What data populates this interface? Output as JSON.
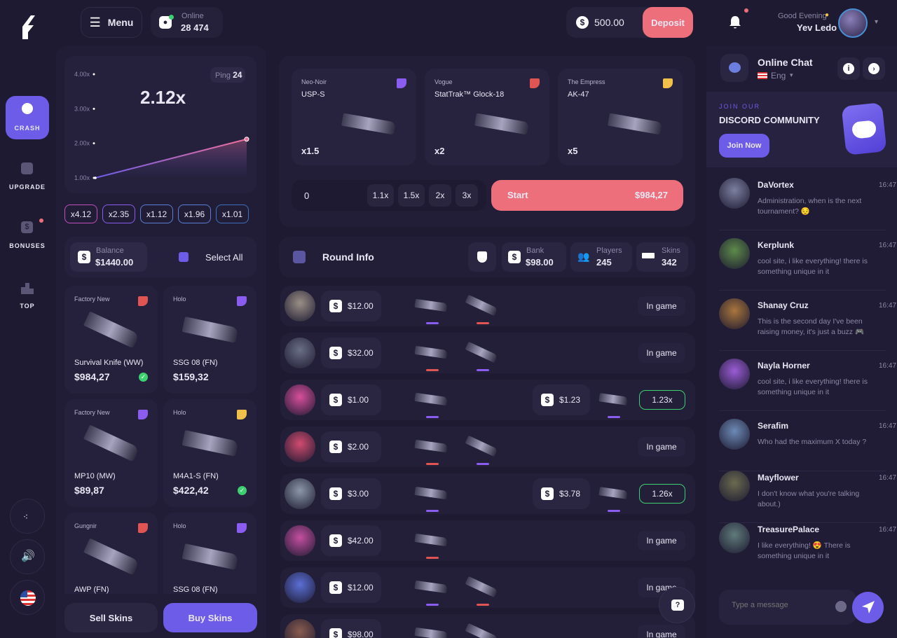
{
  "colors": {
    "bg": "#1d1a31",
    "panel": "#231f39",
    "accent": "#6c5ce7",
    "deposit": "#ee6f7c",
    "start": "#ee6f7c"
  },
  "header": {
    "menu_label": "Menu",
    "online_label": "Online",
    "online_count": "28 474",
    "balance": "500.00",
    "deposit_label": "Deposit",
    "greeting": "Good Evening",
    "username": "Yev Ledo"
  },
  "sidebar": {
    "items": [
      {
        "label": "CRASH",
        "icon": "bomb-icon"
      },
      {
        "label": "UPGRADE",
        "icon": "chart-up-icon"
      },
      {
        "label": "BONUSES",
        "icon": "dollar-icon"
      },
      {
        "label": "TOP",
        "icon": "podium-icon"
      }
    ]
  },
  "crash": {
    "multiplier": "2.12x",
    "ping_label": "Ping",
    "ping_value": "24",
    "y_ticks": [
      "4.00x",
      "3.00x",
      "2.00x",
      "1.00x"
    ],
    "history": [
      "x4.12",
      "x2.35",
      "x1.12",
      "x1.96",
      "x1.01"
    ]
  },
  "chart_data": {
    "type": "line",
    "y_ticks": [
      "4.00x",
      "3.00x",
      "2.00x",
      "1.00x"
    ],
    "ylim": [
      1,
      4
    ],
    "points": [
      {
        "x": 0,
        "y": 1.0
      },
      {
        "x": 1,
        "y": 2.12
      }
    ]
  },
  "inventory": {
    "balance_label": "Balance",
    "balance_value": "$1440.00",
    "select_all": "Select All",
    "items": [
      {
        "condition": "Factory New",
        "name": "Survival Knife (WW)",
        "price": "$984,27",
        "tag": "#e05454",
        "checked": true
      },
      {
        "condition": "Holo",
        "name": "SSG 08 (FN)",
        "price": "$159,32",
        "tag": "#8a5cf0",
        "checked": false
      },
      {
        "condition": "Factory New",
        "name": "MP10 (MW)",
        "price": "$89,87",
        "tag": "#8a5cf0",
        "checked": false
      },
      {
        "condition": "Holo",
        "name": "M4A1-S (FN)",
        "price": "$422,42",
        "tag": "#f0c04a",
        "checked": true
      },
      {
        "condition": "Gungnir",
        "name": "AWP (FN)",
        "price": "",
        "tag": "#e05454",
        "checked": false
      },
      {
        "condition": "Holo",
        "name": "SSG 08 (FN)",
        "price": "",
        "tag": "#8a5cf0",
        "checked": false
      }
    ],
    "sell_label": "Sell Skins",
    "buy_label": "Buy Skins"
  },
  "bet": {
    "skins": [
      {
        "collection": "Neo-Noir",
        "name": "USP-S",
        "mult": "x1.5",
        "tag": "#8a5cf0"
      },
      {
        "collection": "Vogue",
        "name": "StatTrak™ Glock-18",
        "mult": "x2",
        "tag": "#e05454"
      },
      {
        "collection": "The Empress",
        "name": "AK-47",
        "mult": "x5",
        "tag": "#f0c04a"
      }
    ],
    "input_value": "0",
    "quick": [
      "1.1x",
      "1.5x",
      "2x",
      "3x"
    ],
    "start_label": "Start",
    "start_amount": "$984,27"
  },
  "round": {
    "title": "Round Info",
    "bank_label": "Bank",
    "bank_value": "$98.00",
    "players_label": "Players",
    "players_value": "245",
    "skins_label": "Skins",
    "skins_value": "342"
  },
  "players": [
    {
      "bet": "$12.00",
      "status": "In game",
      "won": "",
      "cashout": ""
    },
    {
      "bet": "$32.00",
      "status": "In game",
      "won": "",
      "cashout": ""
    },
    {
      "bet": "$1.00",
      "status": "",
      "won": "$1.23",
      "cashout": "1.23x"
    },
    {
      "bet": "$2.00",
      "status": "In game",
      "won": "",
      "cashout": ""
    },
    {
      "bet": "$3.00",
      "status": "",
      "won": "$3.78",
      "cashout": "1.26x"
    },
    {
      "bet": "$42.00",
      "status": "In game",
      "won": "",
      "cashout": ""
    },
    {
      "bet": "$12.00",
      "status": "In game",
      "won": "",
      "cashout": ""
    },
    {
      "bet": "$98.00",
      "status": "In game",
      "won": "",
      "cashout": ""
    }
  ],
  "chat": {
    "title": "Online Chat",
    "lang": "Eng",
    "join_our": "JOIN OUR",
    "discord_title": "DISCORD COMMUNITY",
    "join_now": "Join Now",
    "placeholder": "Type a message",
    "messages": [
      {
        "user": "DaVortex",
        "time": "16:47",
        "text": "Administration, when is the next tournament? 😔"
      },
      {
        "user": "Kerplunk",
        "time": "16:47",
        "text": "cool site, i like everything! there is something unique in it"
      },
      {
        "user": "Shanay Cruz",
        "time": "16:47",
        "text": "This is the second day I've been raising money, it's just a buzz 🎮"
      },
      {
        "user": "Nayla Horner",
        "time": "16:47",
        "text": "cool site, i like everything! there is something unique in it"
      },
      {
        "user": "Serafim",
        "time": "16:47",
        "text": "Who had the maximum X today ?"
      },
      {
        "user": "Mayflower",
        "time": "16:47",
        "text": "I don't know what you're talking about.)"
      },
      {
        "user": "TreasurePalace",
        "time": "16:47",
        "text": "I like everything! 😍 There is something unique in it"
      }
    ]
  }
}
